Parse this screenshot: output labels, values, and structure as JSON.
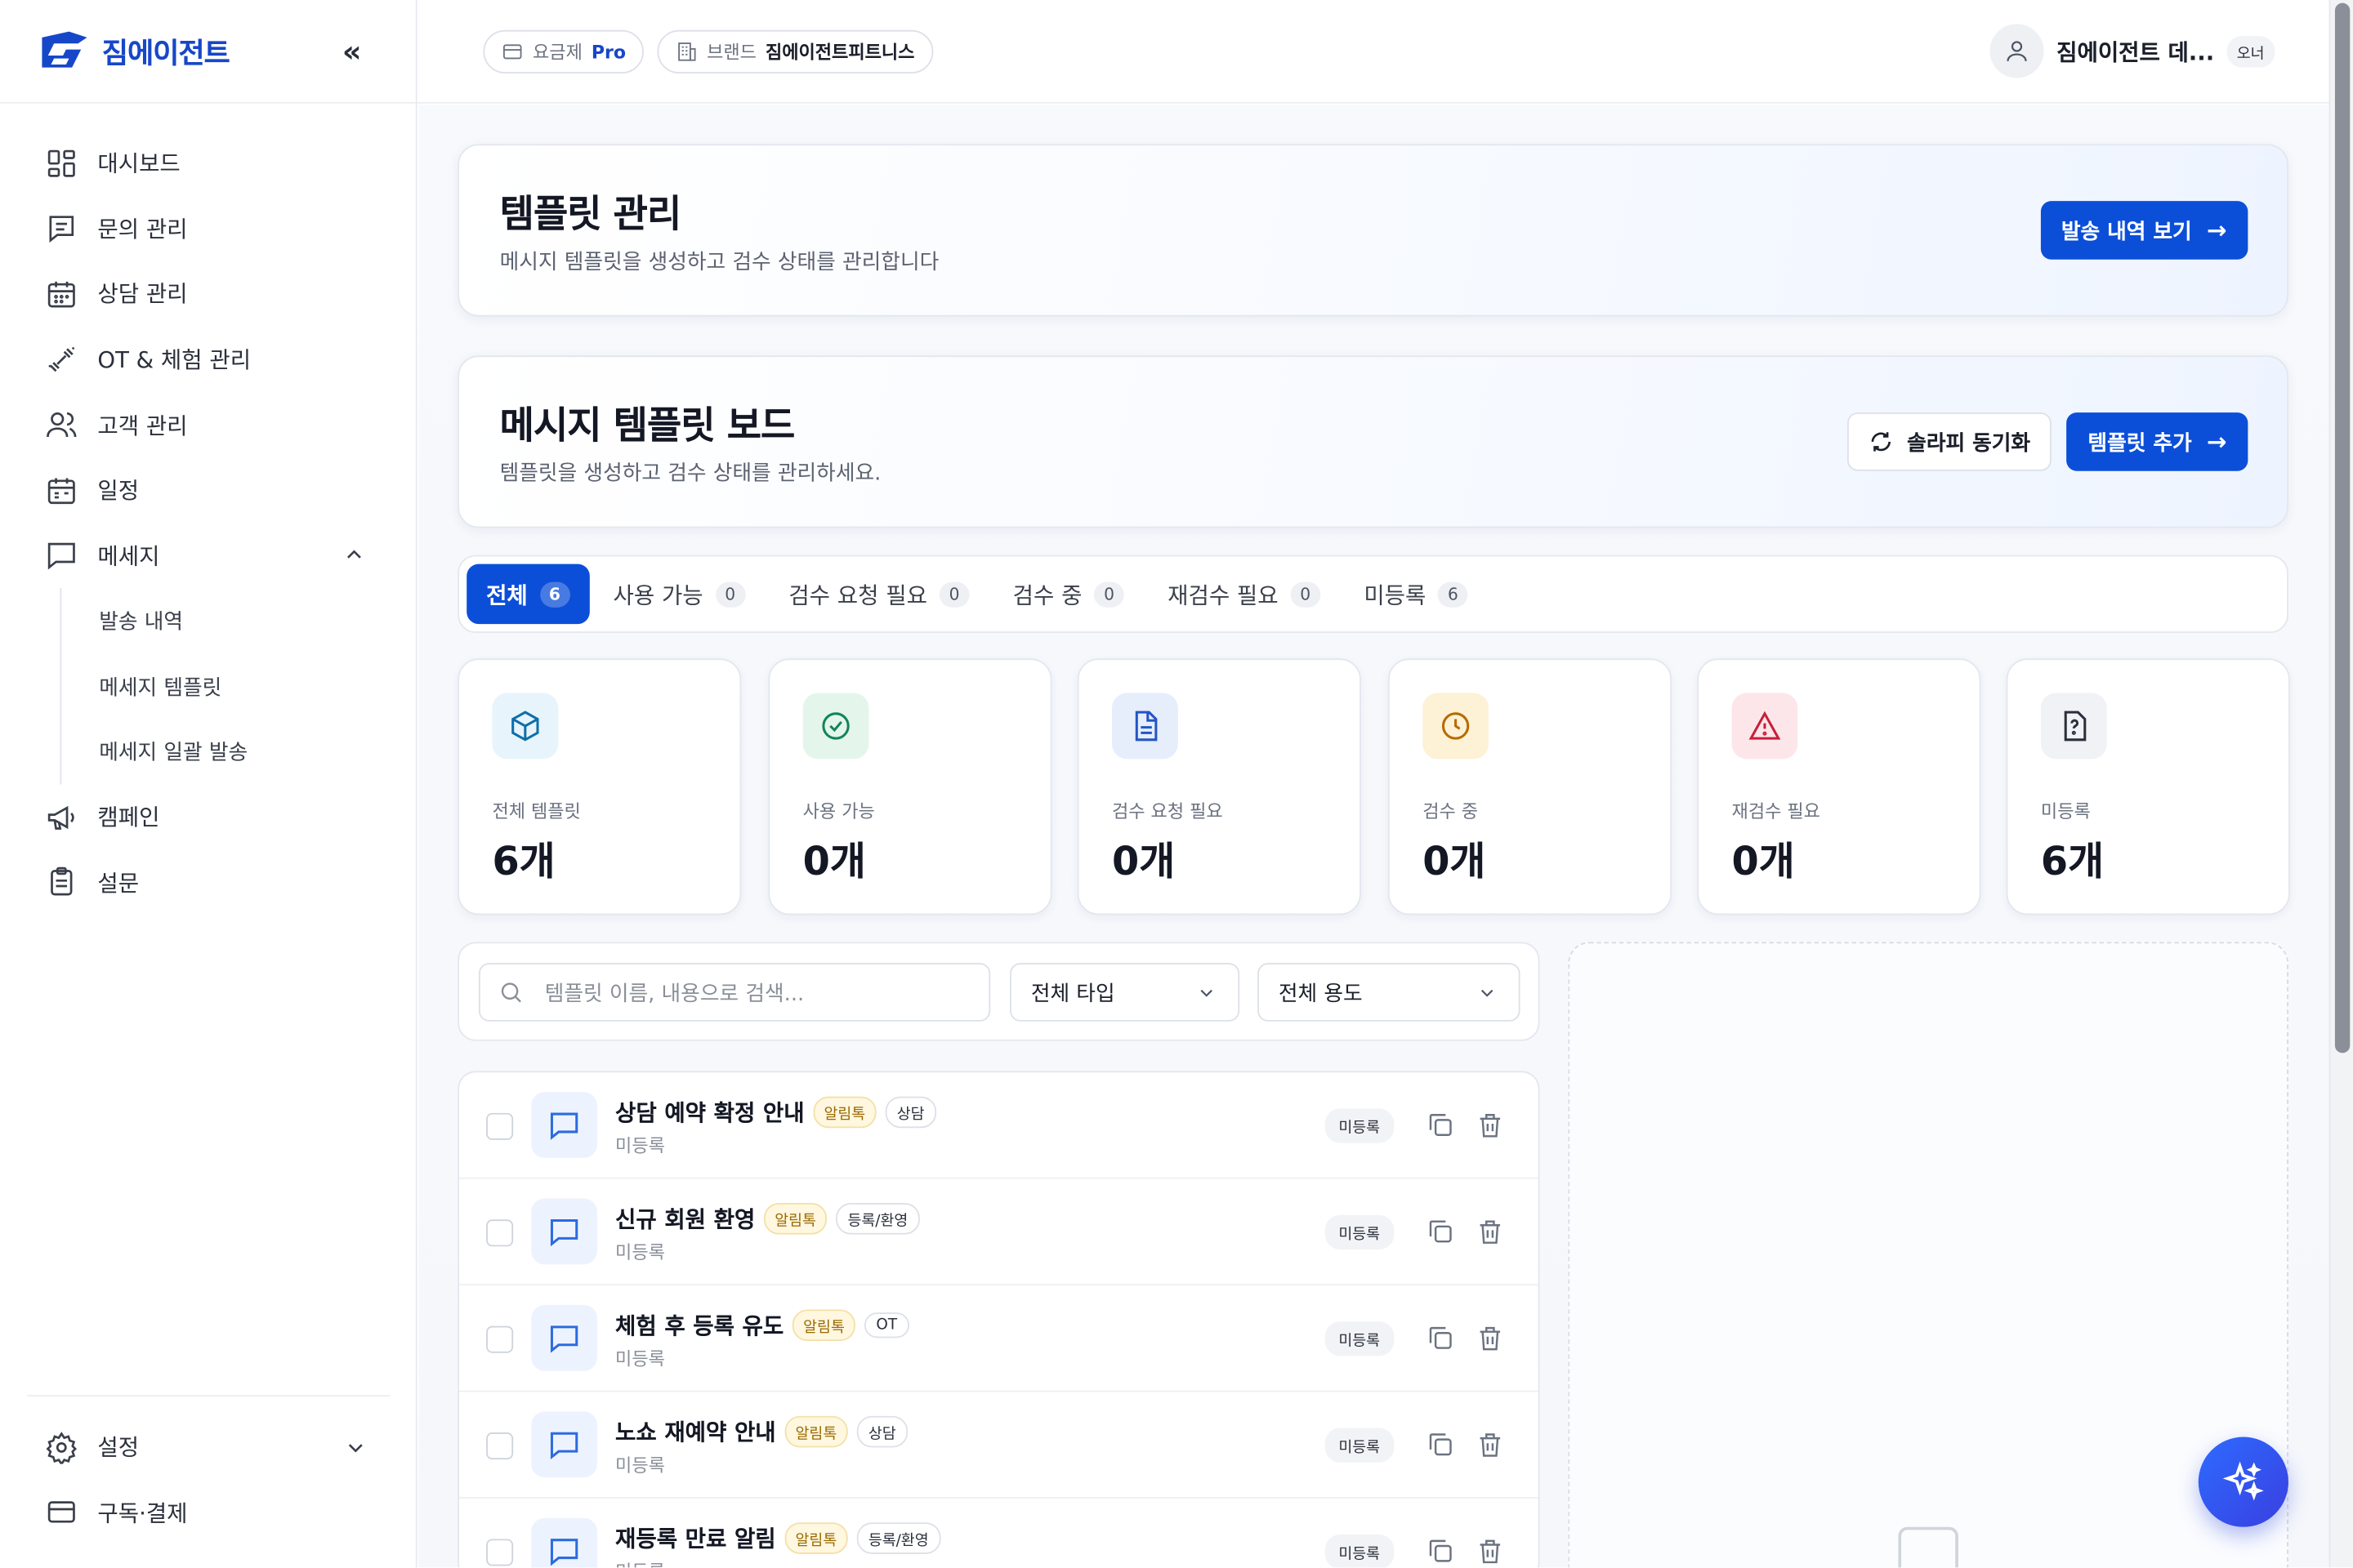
{
  "brand": {
    "name": "짐에이전트",
    "collapse_icon": "«"
  },
  "sidebar": {
    "items": [
      {
        "label": "대시보드",
        "icon": "dashboard-icon"
      },
      {
        "label": "문의 관리",
        "icon": "inquiry-icon"
      },
      {
        "label": "상담 관리",
        "icon": "calendar-icon"
      },
      {
        "label": "OT & 체험 관리",
        "icon": "dumbbell-icon"
      },
      {
        "label": "고객 관리",
        "icon": "users-icon"
      },
      {
        "label": "일정",
        "icon": "schedule-icon"
      },
      {
        "label": "메세지",
        "icon": "message-icon",
        "expanded": true
      }
    ],
    "sub_items": [
      {
        "label": "발송 내역"
      },
      {
        "label": "메세지 템플릿"
      },
      {
        "label": "메세지 일괄 발송"
      }
    ],
    "items2": [
      {
        "label": "캠페인",
        "icon": "megaphone-icon"
      },
      {
        "label": "설문",
        "icon": "clipboard-icon"
      }
    ],
    "bottom": [
      {
        "label": "설정",
        "icon": "gear-icon"
      },
      {
        "label": "구독·결제",
        "icon": "card-icon"
      }
    ]
  },
  "topbar": {
    "plan_label": "요금제",
    "plan_value": "Pro",
    "brand_label": "브랜드",
    "brand_value": "짐에이전트피트니스",
    "user_name": "짐에이전트 데...",
    "user_role": "오너"
  },
  "header_card": {
    "title": "템플릿 관리",
    "subtitle": "메시지 템플릿을 생성하고 검수 상태를 관리합니다",
    "button": "발송 내역 보기"
  },
  "board_card": {
    "title": "메시지 템플릿 보드",
    "subtitle": "템플릿을 생성하고 검수 상태를 관리하세요.",
    "sync_button": "솔라피 동기화",
    "add_button": "템플릿 추가"
  },
  "tabs": [
    {
      "label": "전체",
      "count": "6",
      "active": true
    },
    {
      "label": "사용 가능",
      "count": "0"
    },
    {
      "label": "검수 요청 필요",
      "count": "0"
    },
    {
      "label": "검수 중",
      "count": "0"
    },
    {
      "label": "재검수 필요",
      "count": "0"
    },
    {
      "label": "미등록",
      "count": "6"
    }
  ],
  "stats": [
    {
      "label": "전체 템플릿",
      "value": "6개",
      "icon": "box-icon",
      "bg": "#e7f4fc",
      "color": "#0e6fa8"
    },
    {
      "label": "사용 가능",
      "value": "0개",
      "icon": "check-circle-icon",
      "bg": "#e4f6ec",
      "color": "#13845a"
    },
    {
      "label": "검수 요청 필요",
      "value": "0개",
      "icon": "document-icon",
      "bg": "#e6eefc",
      "color": "#2354c7"
    },
    {
      "label": "검수 중",
      "value": "0개",
      "icon": "clock-icon",
      "bg": "#fdf1d6",
      "color": "#b76a00"
    },
    {
      "label": "재검수 필요",
      "value": "0개",
      "icon": "warning-icon",
      "bg": "#fde6e9",
      "color": "#c81e3a"
    },
    {
      "label": "미등록",
      "value": "6개",
      "icon": "file-question-icon",
      "bg": "#f0f2f5",
      "color": "#2a2f3a"
    }
  ],
  "filter": {
    "search_placeholder": "템플릿 이름, 내용으로 검색...",
    "type_select": "전체 타입",
    "usage_select": "전체 용도"
  },
  "templates": [
    {
      "name": "상담 예약 확정 안내",
      "channel": "알림톡",
      "category": "상담",
      "status": "미등록",
      "pill": "미등록"
    },
    {
      "name": "신규 회원 환영",
      "channel": "알림톡",
      "category": "등록/환영",
      "status": "미등록",
      "pill": "미등록"
    },
    {
      "name": "체험 후 등록 유도",
      "channel": "알림톡",
      "category": "OT",
      "status": "미등록",
      "pill": "미등록"
    },
    {
      "name": "노쇼 재예약 안내",
      "channel": "알림톡",
      "category": "상담",
      "status": "미등록",
      "pill": "미등록"
    },
    {
      "name": "재등록 만료 알림",
      "channel": "알림톡",
      "category": "등록/환영",
      "status": "미등록",
      "pill": "미등록"
    }
  ]
}
